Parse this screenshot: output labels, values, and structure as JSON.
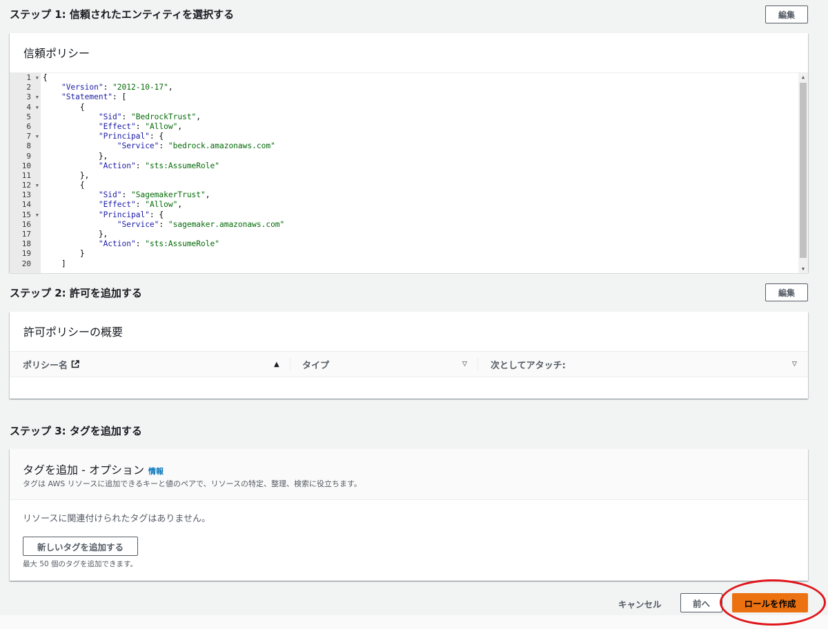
{
  "step1": {
    "title": "ステップ 1: 信頼されたエンティティを選択する",
    "edit_label": "編集",
    "panel_title": "信頼ポリシー",
    "code_lines": [
      "{",
      "    \"Version\": \"2012-10-17\",",
      "    \"Statement\": [",
      "        {",
      "            \"Sid\": \"BedrockTrust\",",
      "            \"Effect\": \"Allow\",",
      "            \"Principal\": {",
      "                \"Service\": \"bedrock.amazonaws.com\"",
      "            },",
      "            \"Action\": \"sts:AssumeRole\"",
      "        },",
      "        {",
      "            \"Sid\": \"SagemakerTrust\",",
      "            \"Effect\": \"Allow\",",
      "            \"Principal\": {",
      "                \"Service\": \"sagemaker.amazonaws.com\"",
      "            },",
      "            \"Action\": \"sts:AssumeRole\"",
      "        }",
      "    ]"
    ],
    "foldable_lines": [
      1,
      3,
      4,
      7,
      12,
      15
    ]
  },
  "step2": {
    "title": "ステップ 2: 許可を追加する",
    "edit_label": "編集",
    "panel_title": "許可ポリシーの概要",
    "columns": {
      "policy_name": "ポリシー名",
      "type": "タイプ",
      "attached_as": "次としてアタッチ:"
    }
  },
  "step3": {
    "title": "ステップ 3: タグを追加する",
    "panel_title": "タグを追加 - オプション",
    "info_label": "情報",
    "description": "タグは AWS リソースに追加できるキーと値のペアで、リソースの特定、整理、検索に役立ちます。",
    "empty_text": "リソースに関連付けられたタグはありません。",
    "add_tag_label": "新しいタグを追加する",
    "limit_text": "最大 50 個のタグを追加できます。"
  },
  "footer": {
    "cancel_label": "キャンセル",
    "previous_label": "前へ",
    "create_label": "ロールを作成"
  },
  "colors": {
    "primary_button": "#ec7211",
    "link": "#0073bb",
    "annotation_ring": "#e0161b"
  }
}
